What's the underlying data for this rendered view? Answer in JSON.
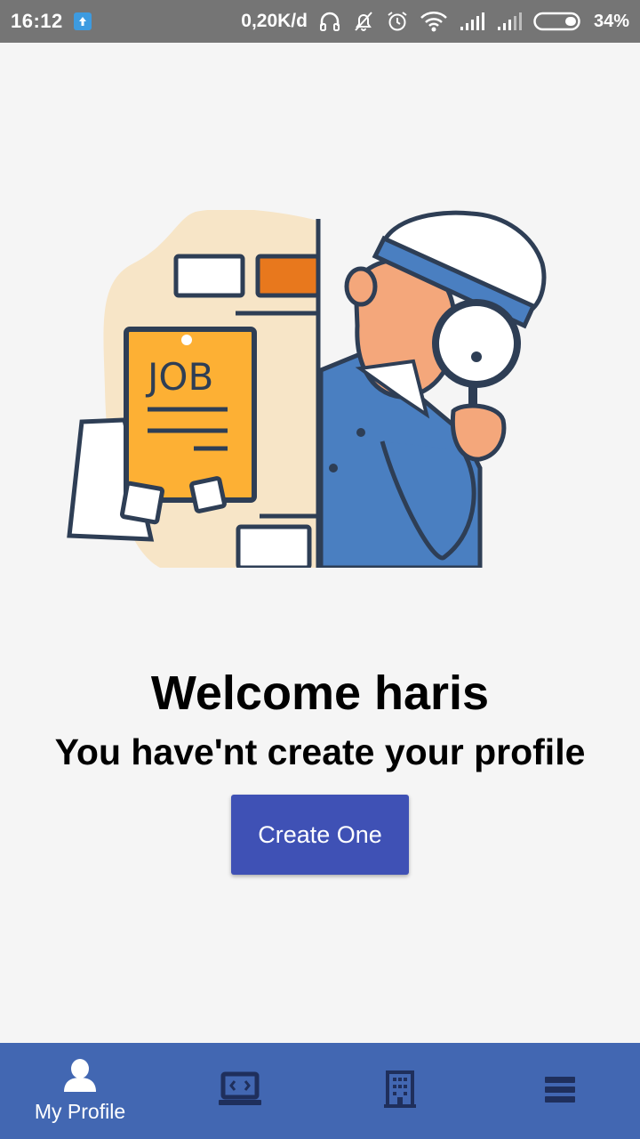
{
  "status_bar": {
    "time": "16:12",
    "network_speed": "0,20K/d",
    "battery": "34%",
    "icons": [
      "upload-notification-icon",
      "headphones-icon",
      "notifications-off-icon",
      "alarm-icon",
      "wifi-icon",
      "signal-icon",
      "signal-icon-2",
      "battery-icon"
    ]
  },
  "main": {
    "illustration_text": "JOB",
    "title": "Welcome haris",
    "subtitle": "You have'nt create your profile",
    "create_button": "Create One"
  },
  "bottom_nav": {
    "items": [
      {
        "label": "My Profile",
        "icon": "person-icon",
        "active": true
      },
      {
        "label": "",
        "icon": "laptop-code-icon",
        "active": false
      },
      {
        "label": "",
        "icon": "building-icon",
        "active": false
      },
      {
        "label": "",
        "icon": "menu-icon",
        "active": false
      }
    ]
  },
  "colors": {
    "status_bar": "#757575",
    "background": "#f5f5f5",
    "button": "#3f51b5",
    "bottom_nav": "#4267b2",
    "nav_icon_inactive": "#1f2f5c"
  }
}
